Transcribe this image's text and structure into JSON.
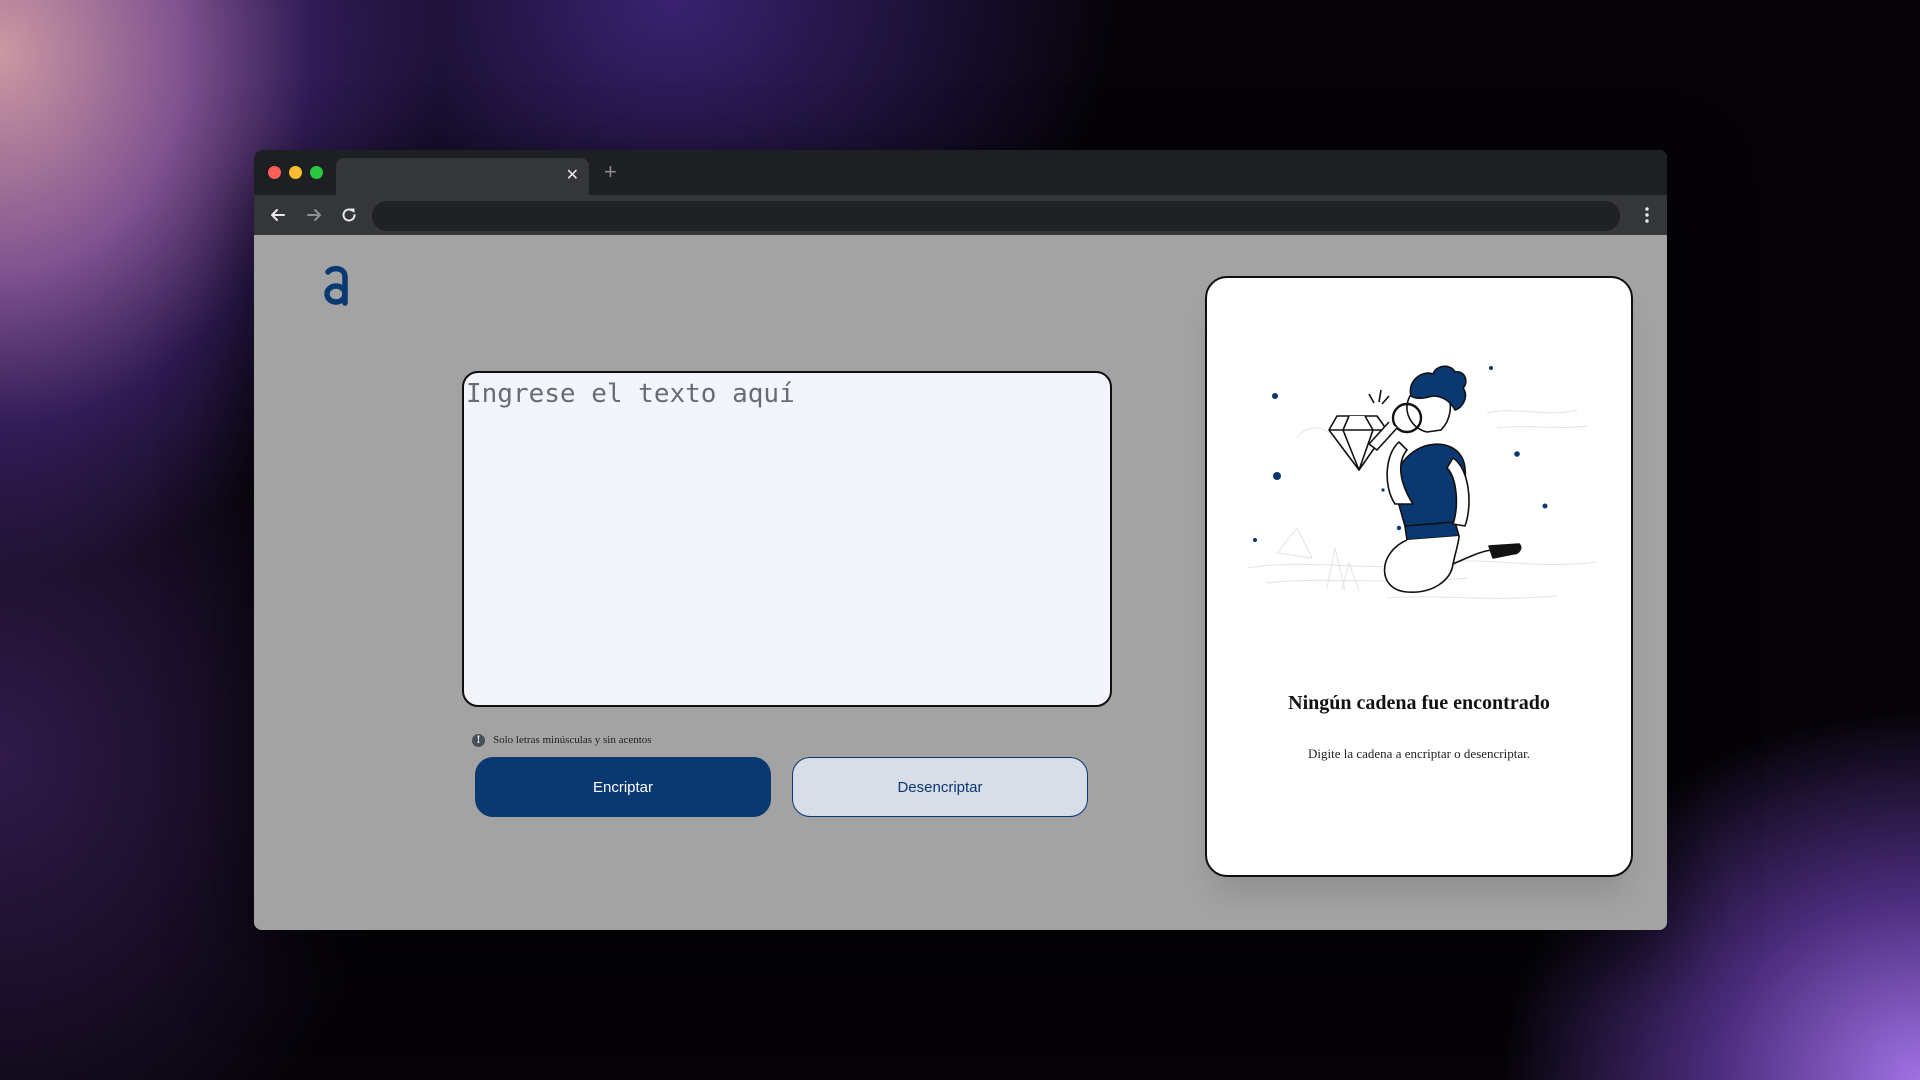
{
  "browser": {
    "tab_close": "✕",
    "new_tab": "+",
    "address": ""
  },
  "app": {
    "logo_letter": "a",
    "input": {
      "placeholder": "Ingrese el texto aquí",
      "value": ""
    },
    "hint": {
      "icon": "!",
      "text": "Solo letras minúsculas y sin acentos"
    },
    "buttons": {
      "encrypt": "Encriptar",
      "decrypt": "Desencriptar"
    },
    "output": {
      "title": "Ningún cadena fue encontrado",
      "subtitle": "Digite la cadena a encriptar o desencriptar."
    }
  },
  "colors": {
    "accent": "#0a3871",
    "page_background": "#a3a3a3",
    "input_background": "#f4f4fd",
    "secondary_button": "#d8dde7"
  },
  "icons": {
    "back": "arrow-left-icon",
    "forward": "arrow-right-icon",
    "reload": "reload-icon",
    "menu": "kebab-menu-icon",
    "hint": "info-icon"
  }
}
